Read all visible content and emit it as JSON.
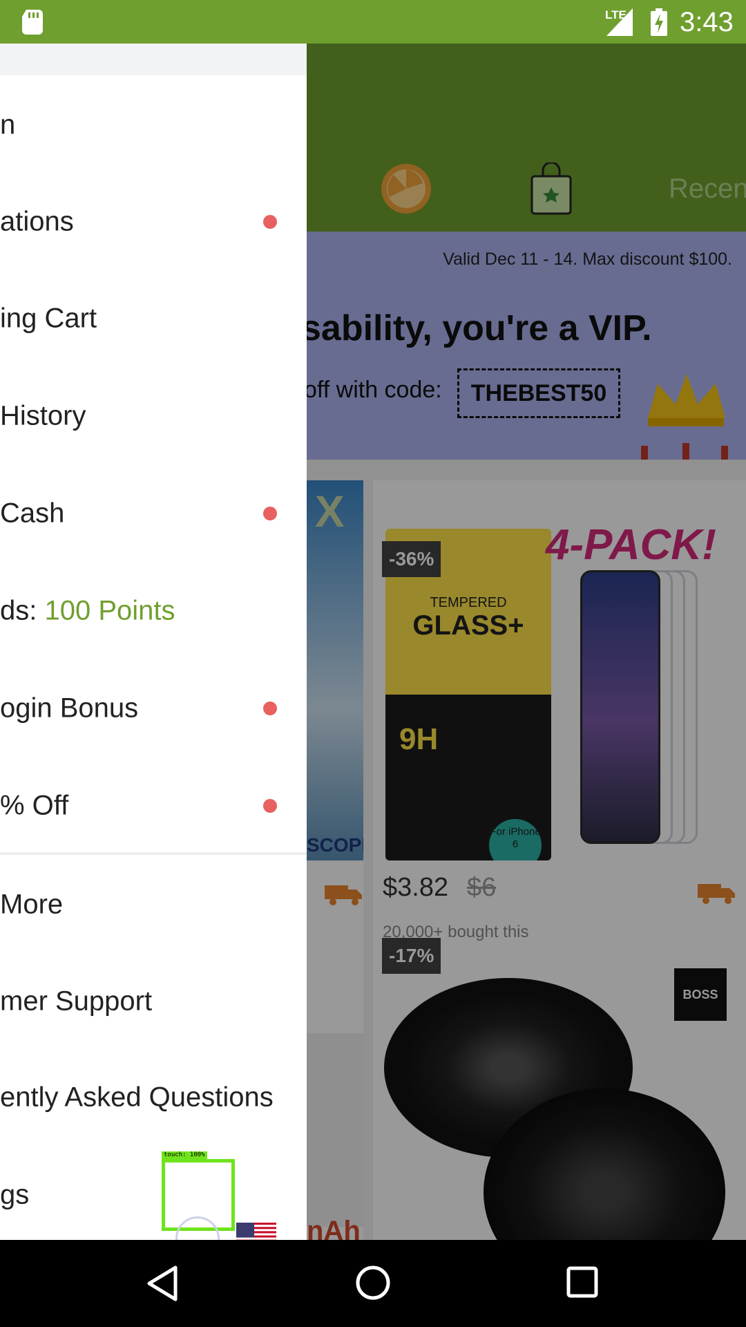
{
  "status_bar": {
    "network": "LTE",
    "time": "3:43",
    "icons": [
      "sd-card-icon",
      "signal-icon",
      "battery-charging-icon"
    ]
  },
  "app": {
    "header": {
      "tab_recent_label": "Recen",
      "icons": [
        "wheel-icon",
        "gift-bag-icon"
      ]
    },
    "promo": {
      "valid_text": "Valid Dec 11 - 14. Max discount $100.",
      "headline": "sability, you're a VIP.",
      "code_label": "off with code:",
      "code": "THEBEST50"
    },
    "left_card": {
      "overlay_letter": "X",
      "caption": "SCOPE",
      "bottom_text": "nAh"
    },
    "products": [
      {
        "discount_badge": "-36%",
        "banner": "4-PACK!",
        "box_line1": "TEMPERED",
        "box_line2": "GLASS+",
        "box_mark": "9H",
        "box_badge": "For iPhone 6",
        "price": "$3.82",
        "old_price": "$6",
        "sold": "20,000+ bought this"
      },
      {
        "discount_badge": "-17%",
        "brand": "BOSS"
      }
    ]
  },
  "drawer": {
    "items": [
      {
        "label": "n",
        "dot": false
      },
      {
        "label": "ations",
        "dot": true
      },
      {
        "label": "ing Cart",
        "dot": false
      },
      {
        "label": "History",
        "dot": false
      },
      {
        "label": "Cash",
        "dot": true
      },
      {
        "label": "ds: ",
        "points": "100 Points",
        "dot": false
      },
      {
        "label": "ogin Bonus",
        "dot": true
      },
      {
        "label": "% Off",
        "dot": true
      },
      {
        "label": "More",
        "dot": false
      },
      {
        "label": "mer Support",
        "dot": false
      },
      {
        "label": "ently Asked Questions",
        "dot": false
      },
      {
        "label": "gs",
        "dot": false
      }
    ],
    "touch_indicator": "touch: 100%",
    "flag": "us-flag-icon"
  },
  "nav_bar": {
    "icons": [
      "back-icon",
      "home-icon",
      "recents-icon"
    ]
  },
  "colors": {
    "brand_green": "#6f9f2f",
    "notification_dot": "#e86060",
    "promo_bg": "#aeb4f2"
  }
}
